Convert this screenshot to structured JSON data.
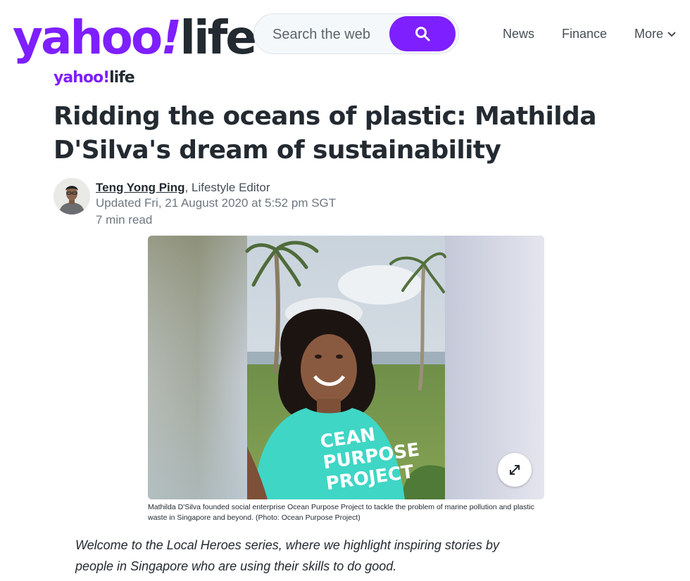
{
  "header": {
    "logo": {
      "part1": "yahoo",
      "bang": "!",
      "part2": "life"
    },
    "search": {
      "placeholder": "Search the web",
      "icon": "search-icon"
    },
    "nav": {
      "news": "News",
      "finance": "Finance",
      "more": "More",
      "more_icon": "chevron-down-icon"
    }
  },
  "article": {
    "brand": {
      "part1": "yahoo",
      "bang": "!",
      "part2": "life"
    },
    "title": "Ridding the oceans of plastic: Mathilda D'Silva's dream of sustainability",
    "author": {
      "name": "Teng Yong Ping",
      "role": ", Lifestyle Editor"
    },
    "updated": "Updated Fri, 21 August 2020 at 5:52 pm SGT",
    "read_time": "7 min read",
    "image": {
      "shirt_text": [
        "CEAN",
        "PURPOSE",
        "PROJECT"
      ],
      "expand_icon": "expand-icon"
    },
    "caption": "Mathilda D'Silva founded social enterprise Ocean Purpose Project to tackle the problem of marine pollution and plastic waste in Singapore and beyond. (Photo: Ocean Purpose Project)",
    "intro": "Welcome to the Local Heroes series, where we highlight inspiring stories by people in Singapore who are using their skills to do good."
  },
  "colors": {
    "brand_purple": "#7e1fff",
    "text_dark": "#232a31",
    "text_muted": "#6e7780",
    "shirt_teal": "#3fd6c5"
  }
}
